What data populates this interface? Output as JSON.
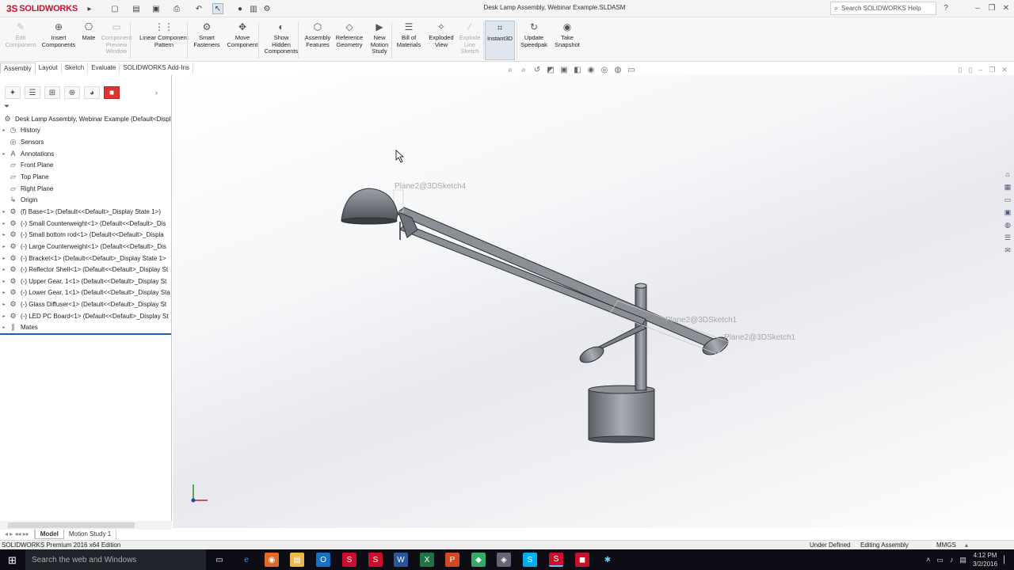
{
  "app": {
    "brand": "SOLIDWORKS",
    "doc_title": "Desk Lamp Assembly, Webinar Example.SLDASM"
  },
  "search": {
    "placeholder": "Search SOLIDWORKS Help"
  },
  "ribbon": {
    "buttons": [
      {
        "label": "Edit\nComponent",
        "icon": "edit-component-icon",
        "enabled": false
      },
      {
        "label": "Insert\nComponents",
        "icon": "insert-components-icon",
        "enabled": true
      },
      {
        "label": "Mate",
        "icon": "mate-icon",
        "enabled": true
      },
      {
        "label": "Component\nPreview\nWindow",
        "icon": "component-preview-icon",
        "enabled": false
      },
      {
        "label": "Linear Component\nPattern",
        "icon": "linear-pattern-icon",
        "enabled": true
      },
      {
        "label": "Smart\nFasteners",
        "icon": "smart-fasteners-icon",
        "enabled": true
      },
      {
        "label": "Move\nComponent",
        "icon": "move-component-icon",
        "enabled": true
      },
      {
        "label": "Show\nHidden\nComponents",
        "icon": "show-hidden-icon",
        "enabled": true
      },
      {
        "label": "Assembly\nFeatures",
        "icon": "assembly-features-icon",
        "enabled": true
      },
      {
        "label": "Reference\nGeometry",
        "icon": "reference-geometry-icon",
        "enabled": true
      },
      {
        "label": "New\nMotion\nStudy",
        "icon": "motion-study-icon",
        "enabled": true
      },
      {
        "label": "Bill of\nMaterials",
        "icon": "bill-of-materials-icon",
        "enabled": true
      },
      {
        "label": "Exploded\nView",
        "icon": "exploded-view-icon",
        "enabled": true
      },
      {
        "label": "Explode\nLine\nSketch",
        "icon": "explode-line-icon",
        "enabled": false
      },
      {
        "label": "Instant3D",
        "icon": "instant3d-icon",
        "enabled": true,
        "active": true
      },
      {
        "label": "Update\nSpeedpak",
        "icon": "speedpak-icon",
        "enabled": true
      },
      {
        "label": "Take\nSnapshot",
        "icon": "snapshot-icon",
        "enabled": true
      }
    ]
  },
  "tabs": [
    "Assembly",
    "Layout",
    "Sketch",
    "Evaluate",
    "SOLIDWORKS Add-Ins"
  ],
  "tree": {
    "root": "Desk Lamp Assembly, Webinar Example  (Default<Displa",
    "items": [
      {
        "label": "History",
        "icon": "history-icon",
        "expand": true
      },
      {
        "label": "Sensors",
        "icon": "sensors-icon",
        "expand": false
      },
      {
        "label": "Annotations",
        "icon": "annotations-icon",
        "expand": true
      },
      {
        "label": "Front Plane",
        "icon": "plane-icon",
        "expand": false
      },
      {
        "label": "Top Plane",
        "icon": "plane-icon",
        "expand": false
      },
      {
        "label": "Right Plane",
        "icon": "plane-icon",
        "expand": false
      },
      {
        "label": "Origin",
        "icon": "origin-icon",
        "expand": false
      },
      {
        "label": "(f) Base<1> (Default<<Default>_Display State 1>)",
        "icon": "part-icon",
        "expand": true
      },
      {
        "label": "(-) Small Counterweight<1> (Default<<Default>_Dis",
        "icon": "part-icon",
        "expand": true
      },
      {
        "label": "(-) Small bottom rod<1> (Default<<Default>_Displa",
        "icon": "part-icon",
        "expand": true
      },
      {
        "label": "(-) Large Counterweight<1> (Default<<Default>_Dis",
        "icon": "part-icon",
        "expand": true
      },
      {
        "label": "(-) Bracket<1> (Default<<Default>_Display State 1>",
        "icon": "part-icon",
        "expand": true
      },
      {
        "label": "(-) Reflector Shell<1> (Default<<Default>_Display St",
        "icon": "part-icon",
        "expand": true
      },
      {
        "label": "(-) Upper Gear, 1<1> (Default<<Default>_Display St",
        "icon": "part-icon",
        "expand": true
      },
      {
        "label": "(-) Lower Gear, 1<1> (Default<<Default>_Display Sta",
        "icon": "part-icon",
        "expand": true
      },
      {
        "label": "(-) Glass Diffuser<1> (Default<<Default>_Display St",
        "icon": "part-icon",
        "expand": true
      },
      {
        "label": "(-) LED PC Board<1> (Default<<Default>_Display St",
        "icon": "part-icon",
        "expand": true
      },
      {
        "label": "Mates",
        "icon": "mates-icon",
        "expand": true
      }
    ]
  },
  "bottom_tabs": [
    "Model",
    "Motion Study 1"
  ],
  "status": {
    "edition": "SOLIDWORKS Premium 2016 x64 Edition",
    "definition": "Under Defined",
    "mode": "Editing Assembly",
    "units": "MMGS"
  },
  "viewport": {
    "labels": [
      "Plane2@3DSketch4",
      "Plane2@3DSketch1",
      "Plane2@3DSketch1"
    ]
  },
  "taskbar": {
    "search": "Search the web and Windows",
    "time": "4:12 PM",
    "date": "3/2/2016"
  },
  "colors": {
    "brand": "#c8102e",
    "selection": "#1a5fb4",
    "taskbar": "#0d0d16"
  }
}
